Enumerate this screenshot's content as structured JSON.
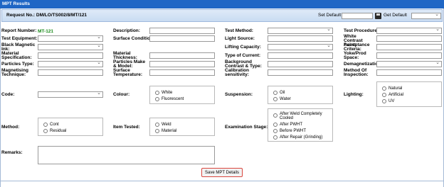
{
  "window": {
    "title": "MPT Results"
  },
  "request": {
    "label": "Request No.: DM/LO/TS002/8/MT/121",
    "set_default": "Set Default",
    "get_default": "Get Default"
  },
  "fields": {
    "report_number": {
      "label": "Report Number:",
      "value": "MT-121"
    },
    "description": "Description:",
    "test_method": "Test Method:",
    "test_procedure": "Test Procedure:",
    "test_equipment": "Test Equipment:",
    "surface_condition": "Surface Condition:",
    "light_source": "Light Source:",
    "white_contrast_paint": "White Contrast Paint:",
    "black_magnetic_ink": "Black Magnetic Ink:",
    "lifting_capacity": "Lifting Capacity:",
    "acceptance_criteria": "Acceptance Criteria:",
    "material_specification": "Material Specification:",
    "material_thickness": "Material Thickness:",
    "type_of_current": "Type of Current:",
    "yoke_prod_space": "Yoke/Prod Space:",
    "particles_type": "Particles Type:",
    "particles_make_model": "Particles Make & Model:",
    "background_contrast_type": "Background Contrast & Type:",
    "demagnetization": "Demagnetization:",
    "magnetising_technique": "Magnetising Technique:",
    "surface_temperature": "Surface Temperature:",
    "calibration_sensitivity": "Calibration sensitivity:",
    "method_of_inspection": "Method Of Inspection:",
    "code": "Code:",
    "colour": "Colour:",
    "suspension": "Suspension:",
    "lighting": "Lighting:",
    "method": "Method:",
    "item_tested": "Item Tested:",
    "examination_stage": "Examination Stage:",
    "remarks": "Remarks:"
  },
  "options": {
    "colour": [
      "White",
      "Fluorescent"
    ],
    "suspension": [
      "Oil",
      "Water"
    ],
    "lighting": [
      "Natural",
      "Artificial",
      "UV"
    ],
    "method": [
      "Cont",
      "Residual"
    ],
    "item_tested": [
      "Weld",
      "Material"
    ],
    "examination_stage": [
      "After Weld Completely Cooled",
      "After PWHT",
      "Before PWHT",
      "After Repair (Grinding)"
    ]
  },
  "actions": {
    "save": "Save MPT Details"
  }
}
